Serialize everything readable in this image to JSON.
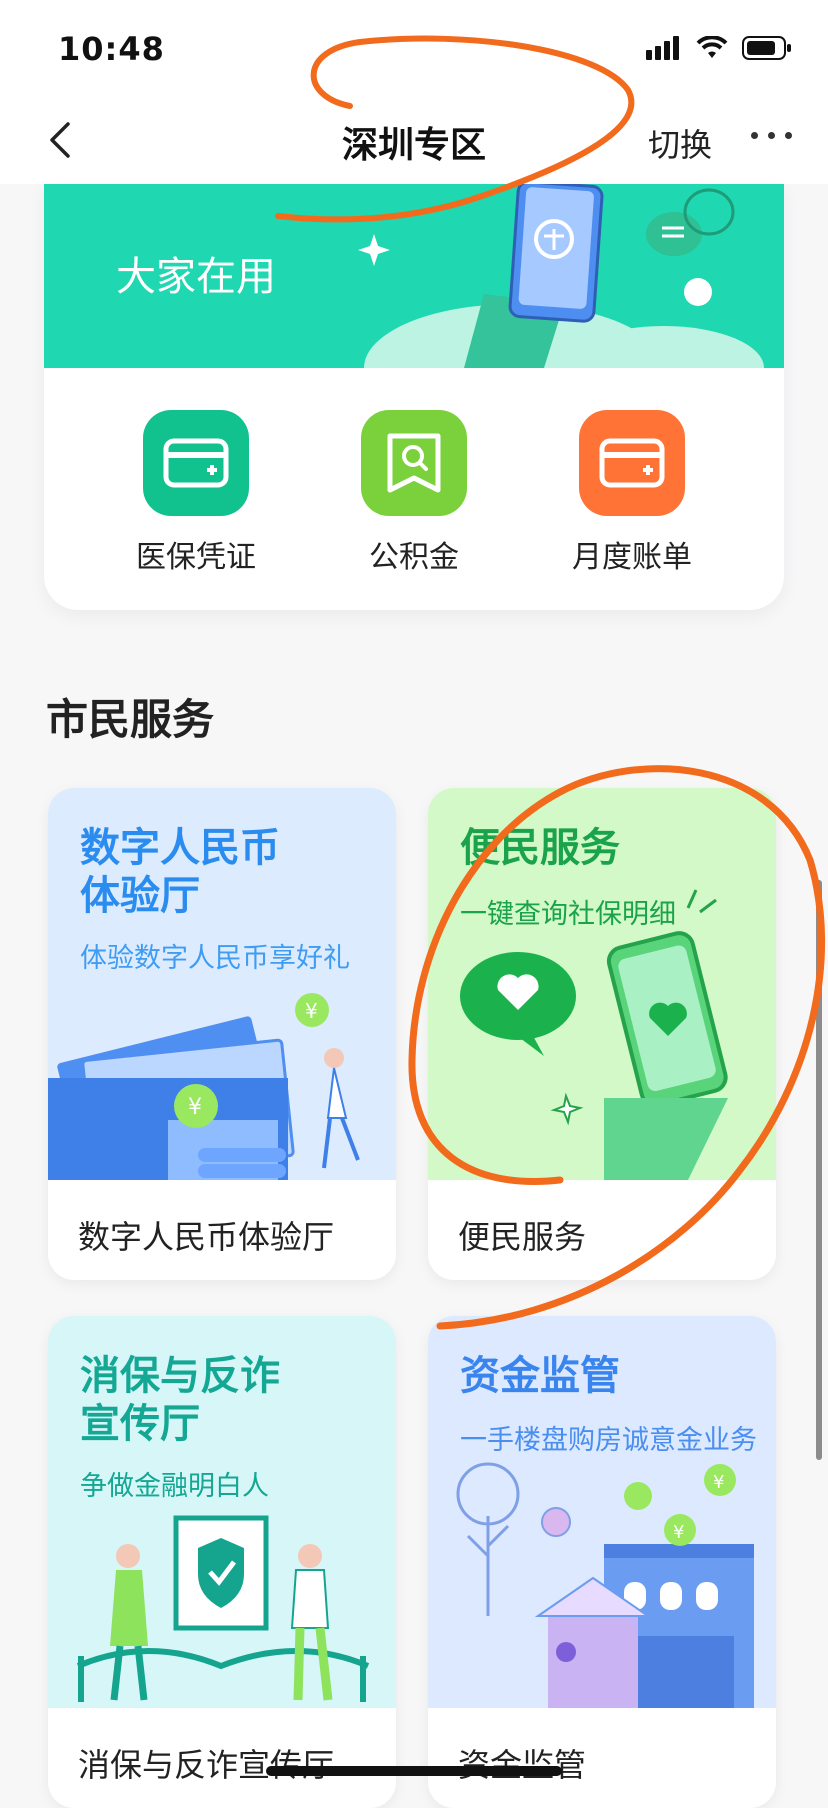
{
  "status_bar": {
    "time": "10:48"
  },
  "nav": {
    "title": "深圳专区",
    "switch_label": "切换"
  },
  "banner": {
    "text": "大家在用"
  },
  "quick_actions": [
    {
      "label": "医保凭证",
      "color": "#12c28e"
    },
    {
      "label": "公积金",
      "color": "#7ad13b"
    },
    {
      "label": "月度账单",
      "color": "#ff7436"
    }
  ],
  "section": {
    "title": "市民服务"
  },
  "services": [
    {
      "title_line1": "数字人民币",
      "title_line2": "体验厅",
      "subtitle": "体验数字人民币享好礼",
      "footer": "数字人民币体验厅",
      "bg": "#dcebfe",
      "title_color": "#2b8cf0"
    },
    {
      "title_line1": "便民服务",
      "title_line2": "",
      "subtitle": "一键查询社保明细",
      "footer": "便民服务",
      "bg": "#d4f9c8",
      "title_color": "#1aa34a"
    },
    {
      "title_line1": "消保与反诈",
      "title_line2": "宣传厅",
      "subtitle": "争做金融明白人",
      "footer": "消保与反诈宣传厅",
      "bg": "#d6f6f8",
      "title_color": "#14a894"
    },
    {
      "title_line1": "资金监管",
      "title_line2": "",
      "subtitle": "一手楼盘购房诚意金业务",
      "footer": "资金监管",
      "bg": "#dce9fe",
      "title_color": "#3a84ee"
    }
  ]
}
